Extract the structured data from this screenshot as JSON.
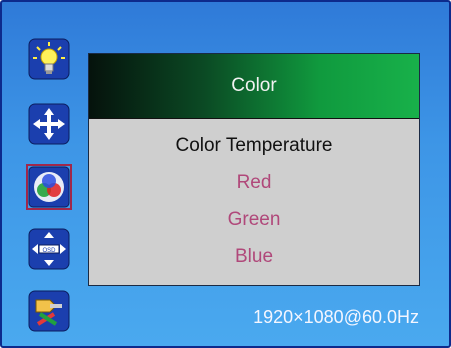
{
  "menu": {
    "title": "Color",
    "items": [
      {
        "label": "Color Temperature",
        "state": "active"
      },
      {
        "label": "Red",
        "state": "normal"
      },
      {
        "label": "Green",
        "state": "normal"
      },
      {
        "label": "Blue",
        "state": "normal"
      }
    ]
  },
  "sidebar": {
    "icons": [
      {
        "name": "brightness-bulb-icon",
        "selected": false
      },
      {
        "name": "position-arrows-icon",
        "selected": false
      },
      {
        "name": "color-rgb-icon",
        "selected": true
      },
      {
        "name": "resolution-osd-icon",
        "selected": false
      },
      {
        "name": "tools-icon",
        "selected": false
      }
    ]
  },
  "status": {
    "resolution": "1920×1080@60.0Hz"
  },
  "colors": {
    "background": "#3d95e6",
    "panel": "#cfcfcf",
    "header_start": "#05120c",
    "header_end": "#18b14a",
    "item_text": "#b0487a",
    "active_text": "#111111",
    "selection": "#a0284b"
  }
}
